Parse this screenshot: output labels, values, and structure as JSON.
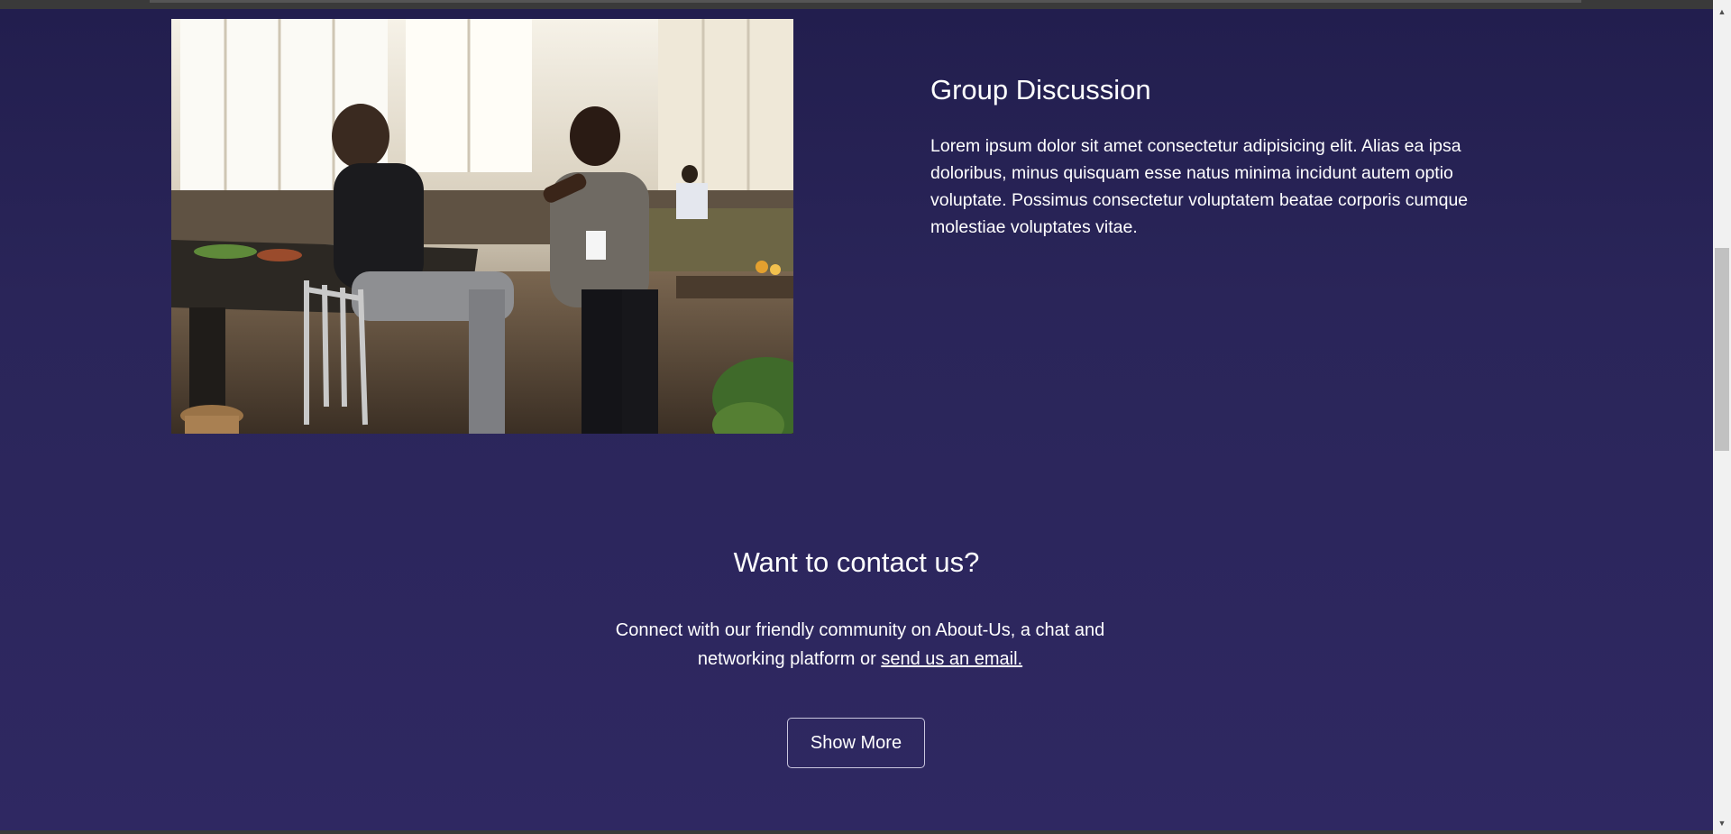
{
  "feature": {
    "title": "Group Discussion",
    "text": "Lorem ipsum dolor sit amet consectetur adipisicing elit. Alias ea ipsa doloribus, minus quisquam esse natus minima incidunt autem optio voluptate. Possimus consectetur voluptatem beatae corporis cumque molestiae voluptates vitae."
  },
  "contact": {
    "title": "Want to contact us?",
    "text_before_link": "Connect with our friendly community on About-Us, a chat and networking platform or ",
    "link_text": "send us an email.",
    "button_label": "Show More"
  },
  "colors": {
    "background": "#2c2660",
    "text": "#ffffff",
    "button_border": "#c9c6de"
  },
  "icons": {
    "scroll_up": "scroll-up-arrow-icon",
    "scroll_down": "scroll-down-arrow-icon"
  }
}
